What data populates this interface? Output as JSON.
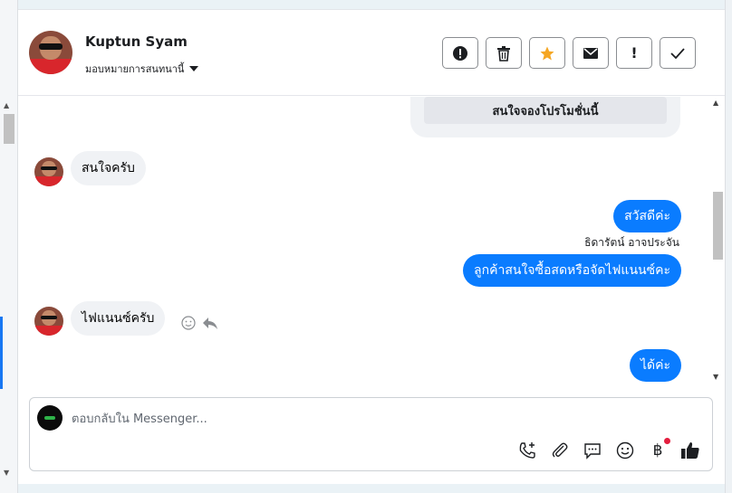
{
  "header": {
    "contact_name": "Kuptun Syam",
    "assign_label": "มอบหมายการสนทนานี้",
    "actions": [
      {
        "name": "report-button",
        "icon": "alert-circle-icon"
      },
      {
        "name": "delete-button",
        "icon": "trash-icon"
      },
      {
        "name": "star-button",
        "icon": "star-icon"
      },
      {
        "name": "mark-unread-button",
        "icon": "envelope-icon"
      },
      {
        "name": "spam-button",
        "icon": "exclamation-icon"
      },
      {
        "name": "done-button",
        "icon": "check-icon"
      }
    ]
  },
  "thread": {
    "promo_button": "สนใจจองโปรโมชั่นนี้",
    "messages": {
      "in_1": "สนใจครับ",
      "out_1": "สวัสดีค่ะ",
      "sender_name": "ธิดารัตน์ อาจประจัน",
      "out_2": "ลูกค้าสนใจซื้อสดหรือจัดไฟแนนซ์คะ",
      "in_2": "ไฟแนนซ์ครับ",
      "out_3": "ได้ค่ะ"
    }
  },
  "composer": {
    "placeholder": "ตอบกลับใน Messenger...",
    "tools": [
      "call-icon",
      "attachment-icon",
      "saved-reply-icon",
      "emoji-icon",
      "baht-payment-icon",
      "like-icon"
    ]
  },
  "colors": {
    "accent": "#0a7cff",
    "star": "#f5a623",
    "notification": "#e41e3f"
  }
}
